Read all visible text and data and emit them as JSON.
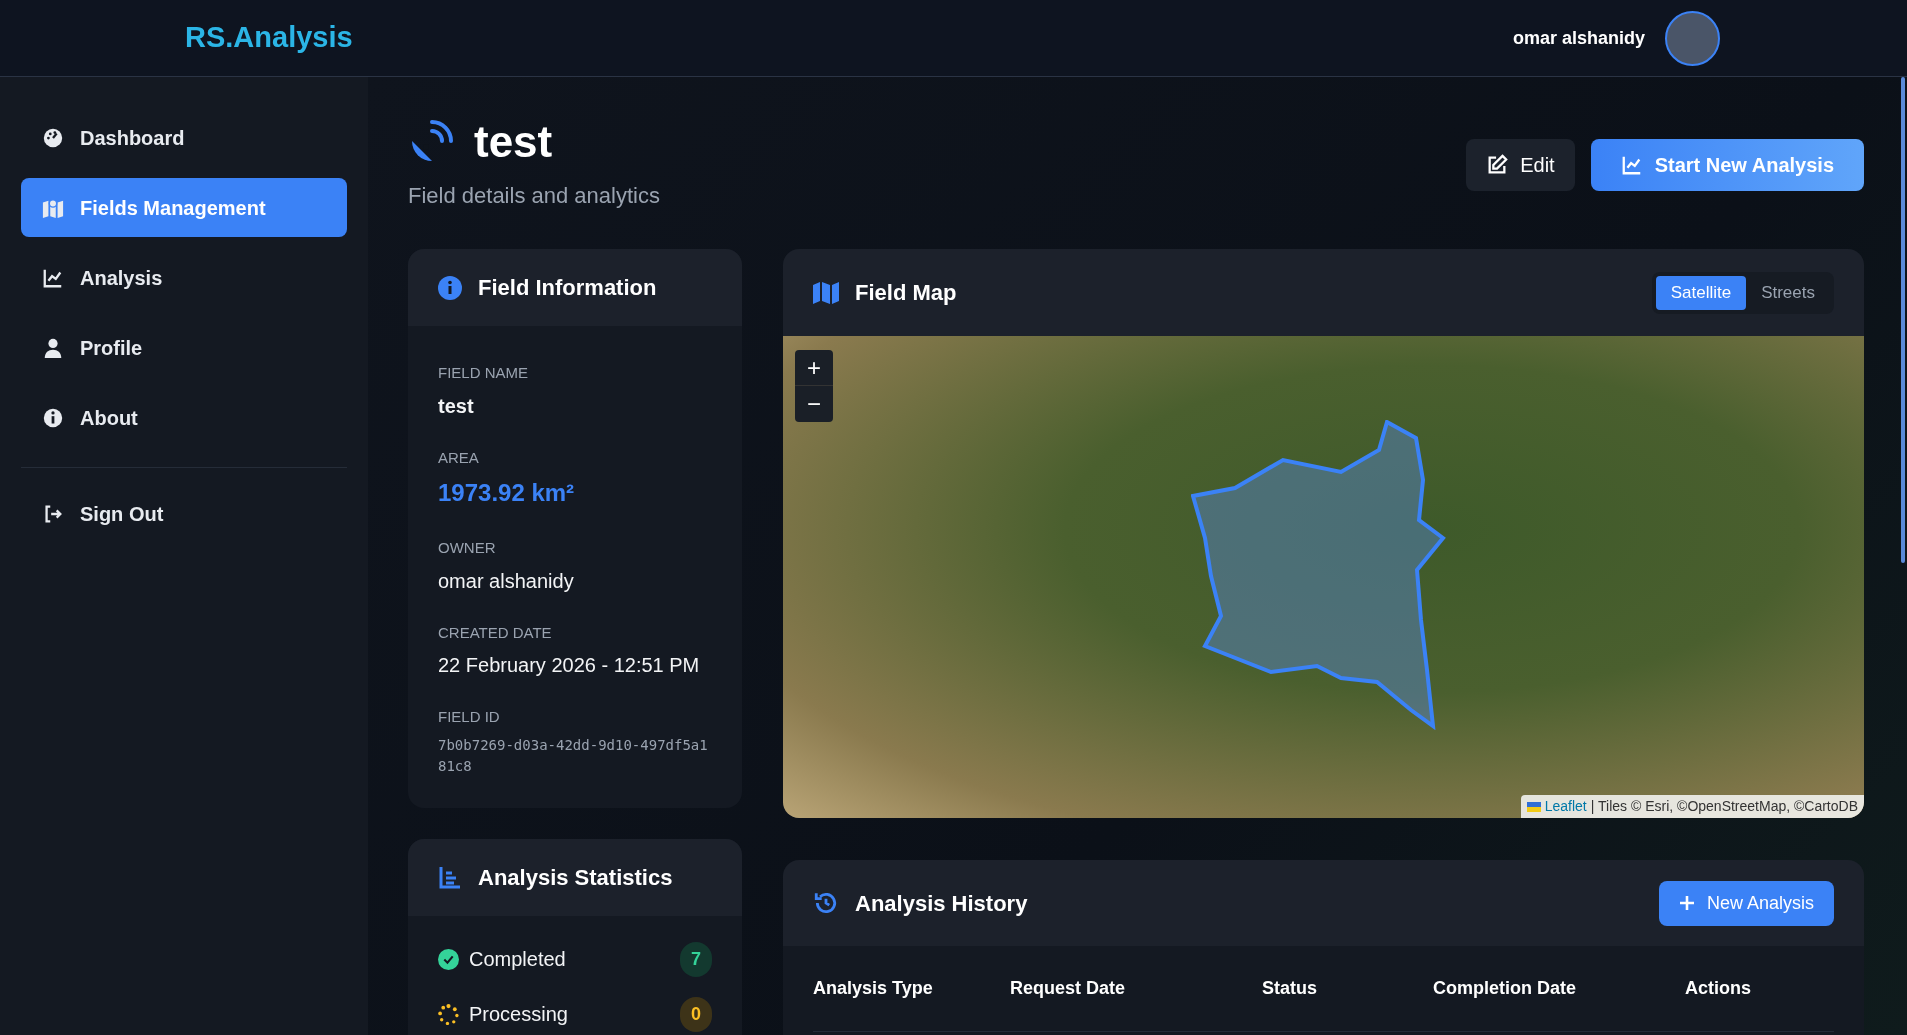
{
  "header": {
    "logo": "RS.Analysis",
    "user_name": "omar alshanidy"
  },
  "sidebar": {
    "items": [
      {
        "label": "Dashboard",
        "kind": "dashboard",
        "selected": false
      },
      {
        "label": "Fields Management",
        "kind": "map",
        "selected": true
      },
      {
        "label": "Analysis",
        "kind": "chart",
        "selected": false
      },
      {
        "label": "Profile",
        "kind": "user",
        "selected": false
      },
      {
        "label": "About",
        "kind": "info",
        "selected": false
      }
    ],
    "sign_out": "Sign Out"
  },
  "page": {
    "title": "test",
    "subtitle": "Field details and analytics",
    "edit_button": "Edit",
    "start_button": "Start New Analysis"
  },
  "field_information": {
    "title": "Field Information",
    "fields": [
      {
        "label": "FIELD NAME",
        "value": "test",
        "kind": "text"
      },
      {
        "label": "AREA",
        "value": "1973.92 km²",
        "kind": "highlight"
      },
      {
        "label": "OWNER",
        "value": "omar alshanidy",
        "kind": "text"
      },
      {
        "label": "CREATED DATE",
        "value": "22 February 2026 - 12:51 PM",
        "kind": "text"
      },
      {
        "label": "FIELD ID",
        "value": "7b0b7269-d03a-42dd-9d10-497df5a181c8",
        "kind": "code"
      }
    ]
  },
  "analysis_statistics": {
    "title": "Analysis Statistics",
    "items": [
      {
        "label": "Completed",
        "count": "7",
        "kind": "completed"
      },
      {
        "label": "Processing",
        "count": "0",
        "kind": "processing"
      }
    ]
  },
  "field_map": {
    "title": "Field Map",
    "layers": [
      {
        "label": "Satellite",
        "selected": true
      },
      {
        "label": "Streets",
        "selected": false
      }
    ],
    "zoom_in": "+",
    "zoom_out": "−",
    "attribution_link": "Leaflet",
    "attribution": "| Tiles © Esri, ©OpenStreetMap, ©CartoDB"
  },
  "analysis_history": {
    "title": "Analysis History",
    "new_button": "New Analysis",
    "columns": [
      "Analysis Type",
      "Request Date",
      "Status",
      "Completion Date",
      "Actions"
    ]
  }
}
